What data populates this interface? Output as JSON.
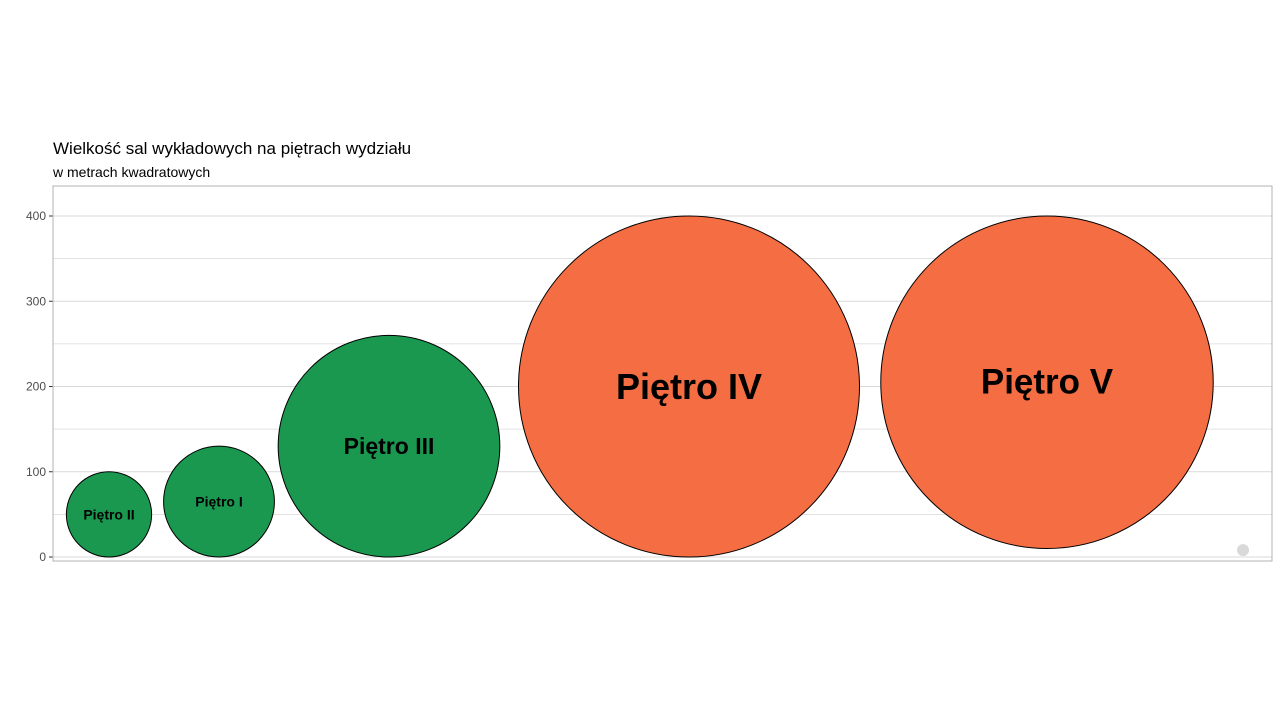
{
  "chart_data": {
    "type": "bubble",
    "title": "Wielkość sal wykładowych na piętrach wydziału",
    "subtitle": "w metrach kwadratowych",
    "xlabel": "",
    "ylabel": "",
    "ylim": [
      0,
      400
    ],
    "y_ticks": [
      0,
      100,
      200,
      300,
      400
    ],
    "grid": true,
    "legend": "none",
    "colors": {
      "green": "#1a9850",
      "orange": "#f46d43",
      "point_grey": "#d9d9d9",
      "grid": "#d9d9d9",
      "panel_border": "#b3b3b3"
    },
    "bubbles": [
      {
        "label": "Piętro II",
        "y": 50,
        "size": 100,
        "color": "green"
      },
      {
        "label": "Piętro I",
        "y": 65,
        "size": 130,
        "color": "green"
      },
      {
        "label": "Piętro III",
        "y": 130,
        "size": 260,
        "color": "green"
      },
      {
        "label": "Piętro IV",
        "y": 200,
        "size": 400,
        "color": "orange"
      },
      {
        "label": "Piętro V",
        "y": 205,
        "size": 390,
        "color": "orange"
      }
    ],
    "extra_points": [
      {
        "y": 8,
        "color": "point_grey"
      }
    ]
  }
}
